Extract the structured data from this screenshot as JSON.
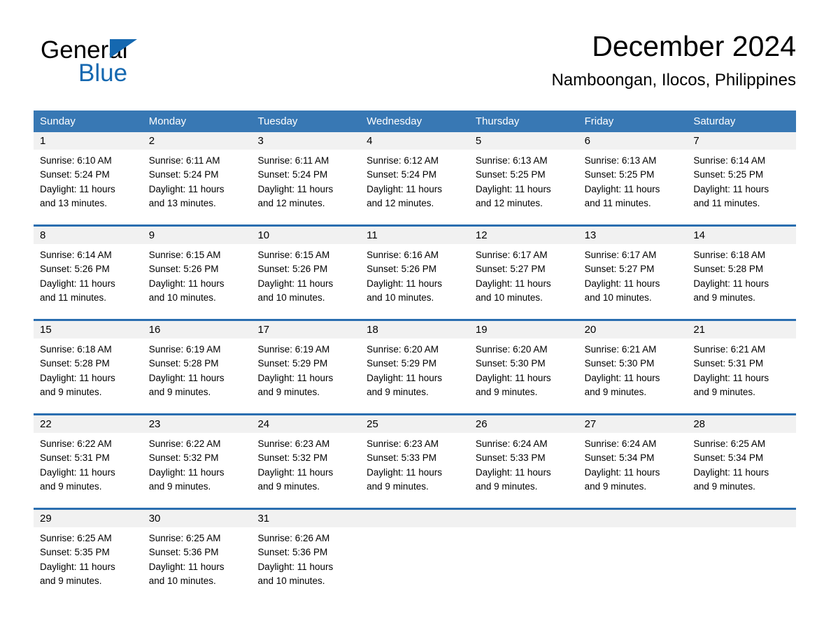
{
  "brand": {
    "name_part1": "General",
    "name_part2": "Blue",
    "triangle_color": "#1568b0"
  },
  "header": {
    "title": "December 2024",
    "subtitle": "Namboongan, Ilocos, Philippines"
  },
  "theme": {
    "header_bg": "#3878b4",
    "week_border": "#2a6eb0",
    "day_band_bg": "#f1f1f1",
    "text": "#000000"
  },
  "weekdays": [
    "Sunday",
    "Monday",
    "Tuesday",
    "Wednesday",
    "Thursday",
    "Friday",
    "Saturday"
  ],
  "labels": {
    "sunrise_prefix": "Sunrise:",
    "sunset_prefix": "Sunset:",
    "daylight_prefix": "Daylight:"
  },
  "weeks": [
    [
      {
        "day": "1",
        "sunrise": "Sunrise: 6:10 AM",
        "sunset": "Sunset: 5:24 PM",
        "daylight_line1": "Daylight: 11 hours",
        "daylight_line2": "and 13 minutes."
      },
      {
        "day": "2",
        "sunrise": "Sunrise: 6:11 AM",
        "sunset": "Sunset: 5:24 PM",
        "daylight_line1": "Daylight: 11 hours",
        "daylight_line2": "and 13 minutes."
      },
      {
        "day": "3",
        "sunrise": "Sunrise: 6:11 AM",
        "sunset": "Sunset: 5:24 PM",
        "daylight_line1": "Daylight: 11 hours",
        "daylight_line2": "and 12 minutes."
      },
      {
        "day": "4",
        "sunrise": "Sunrise: 6:12 AM",
        "sunset": "Sunset: 5:24 PM",
        "daylight_line1": "Daylight: 11 hours",
        "daylight_line2": "and 12 minutes."
      },
      {
        "day": "5",
        "sunrise": "Sunrise: 6:13 AM",
        "sunset": "Sunset: 5:25 PM",
        "daylight_line1": "Daylight: 11 hours",
        "daylight_line2": "and 12 minutes."
      },
      {
        "day": "6",
        "sunrise": "Sunrise: 6:13 AM",
        "sunset": "Sunset: 5:25 PM",
        "daylight_line1": "Daylight: 11 hours",
        "daylight_line2": "and 11 minutes."
      },
      {
        "day": "7",
        "sunrise": "Sunrise: 6:14 AM",
        "sunset": "Sunset: 5:25 PM",
        "daylight_line1": "Daylight: 11 hours",
        "daylight_line2": "and 11 minutes."
      }
    ],
    [
      {
        "day": "8",
        "sunrise": "Sunrise: 6:14 AM",
        "sunset": "Sunset: 5:26 PM",
        "daylight_line1": "Daylight: 11 hours",
        "daylight_line2": "and 11 minutes."
      },
      {
        "day": "9",
        "sunrise": "Sunrise: 6:15 AM",
        "sunset": "Sunset: 5:26 PM",
        "daylight_line1": "Daylight: 11 hours",
        "daylight_line2": "and 10 minutes."
      },
      {
        "day": "10",
        "sunrise": "Sunrise: 6:15 AM",
        "sunset": "Sunset: 5:26 PM",
        "daylight_line1": "Daylight: 11 hours",
        "daylight_line2": "and 10 minutes."
      },
      {
        "day": "11",
        "sunrise": "Sunrise: 6:16 AM",
        "sunset": "Sunset: 5:26 PM",
        "daylight_line1": "Daylight: 11 hours",
        "daylight_line2": "and 10 minutes."
      },
      {
        "day": "12",
        "sunrise": "Sunrise: 6:17 AM",
        "sunset": "Sunset: 5:27 PM",
        "daylight_line1": "Daylight: 11 hours",
        "daylight_line2": "and 10 minutes."
      },
      {
        "day": "13",
        "sunrise": "Sunrise: 6:17 AM",
        "sunset": "Sunset: 5:27 PM",
        "daylight_line1": "Daylight: 11 hours",
        "daylight_line2": "and 10 minutes."
      },
      {
        "day": "14",
        "sunrise": "Sunrise: 6:18 AM",
        "sunset": "Sunset: 5:28 PM",
        "daylight_line1": "Daylight: 11 hours",
        "daylight_line2": "and 9 minutes."
      }
    ],
    [
      {
        "day": "15",
        "sunrise": "Sunrise: 6:18 AM",
        "sunset": "Sunset: 5:28 PM",
        "daylight_line1": "Daylight: 11 hours",
        "daylight_line2": "and 9 minutes."
      },
      {
        "day": "16",
        "sunrise": "Sunrise: 6:19 AM",
        "sunset": "Sunset: 5:28 PM",
        "daylight_line1": "Daylight: 11 hours",
        "daylight_line2": "and 9 minutes."
      },
      {
        "day": "17",
        "sunrise": "Sunrise: 6:19 AM",
        "sunset": "Sunset: 5:29 PM",
        "daylight_line1": "Daylight: 11 hours",
        "daylight_line2": "and 9 minutes."
      },
      {
        "day": "18",
        "sunrise": "Sunrise: 6:20 AM",
        "sunset": "Sunset: 5:29 PM",
        "daylight_line1": "Daylight: 11 hours",
        "daylight_line2": "and 9 minutes."
      },
      {
        "day": "19",
        "sunrise": "Sunrise: 6:20 AM",
        "sunset": "Sunset: 5:30 PM",
        "daylight_line1": "Daylight: 11 hours",
        "daylight_line2": "and 9 minutes."
      },
      {
        "day": "20",
        "sunrise": "Sunrise: 6:21 AM",
        "sunset": "Sunset: 5:30 PM",
        "daylight_line1": "Daylight: 11 hours",
        "daylight_line2": "and 9 minutes."
      },
      {
        "day": "21",
        "sunrise": "Sunrise: 6:21 AM",
        "sunset": "Sunset: 5:31 PM",
        "daylight_line1": "Daylight: 11 hours",
        "daylight_line2": "and 9 minutes."
      }
    ],
    [
      {
        "day": "22",
        "sunrise": "Sunrise: 6:22 AM",
        "sunset": "Sunset: 5:31 PM",
        "daylight_line1": "Daylight: 11 hours",
        "daylight_line2": "and 9 minutes."
      },
      {
        "day": "23",
        "sunrise": "Sunrise: 6:22 AM",
        "sunset": "Sunset: 5:32 PM",
        "daylight_line1": "Daylight: 11 hours",
        "daylight_line2": "and 9 minutes."
      },
      {
        "day": "24",
        "sunrise": "Sunrise: 6:23 AM",
        "sunset": "Sunset: 5:32 PM",
        "daylight_line1": "Daylight: 11 hours",
        "daylight_line2": "and 9 minutes."
      },
      {
        "day": "25",
        "sunrise": "Sunrise: 6:23 AM",
        "sunset": "Sunset: 5:33 PM",
        "daylight_line1": "Daylight: 11 hours",
        "daylight_line2": "and 9 minutes."
      },
      {
        "day": "26",
        "sunrise": "Sunrise: 6:24 AM",
        "sunset": "Sunset: 5:33 PM",
        "daylight_line1": "Daylight: 11 hours",
        "daylight_line2": "and 9 minutes."
      },
      {
        "day": "27",
        "sunrise": "Sunrise: 6:24 AM",
        "sunset": "Sunset: 5:34 PM",
        "daylight_line1": "Daylight: 11 hours",
        "daylight_line2": "and 9 minutes."
      },
      {
        "day": "28",
        "sunrise": "Sunrise: 6:25 AM",
        "sunset": "Sunset: 5:34 PM",
        "daylight_line1": "Daylight: 11 hours",
        "daylight_line2": "and 9 minutes."
      }
    ],
    [
      {
        "day": "29",
        "sunrise": "Sunrise: 6:25 AM",
        "sunset": "Sunset: 5:35 PM",
        "daylight_line1": "Daylight: 11 hours",
        "daylight_line2": "and 9 minutes."
      },
      {
        "day": "30",
        "sunrise": "Sunrise: 6:25 AM",
        "sunset": "Sunset: 5:36 PM",
        "daylight_line1": "Daylight: 11 hours",
        "daylight_line2": "and 10 minutes."
      },
      {
        "day": "31",
        "sunrise": "Sunrise: 6:26 AM",
        "sunset": "Sunset: 5:36 PM",
        "daylight_line1": "Daylight: 11 hours",
        "daylight_line2": "and 10 minutes."
      },
      {
        "day": "",
        "sunrise": "",
        "sunset": "",
        "daylight_line1": "",
        "daylight_line2": ""
      },
      {
        "day": "",
        "sunrise": "",
        "sunset": "",
        "daylight_line1": "",
        "daylight_line2": ""
      },
      {
        "day": "",
        "sunrise": "",
        "sunset": "",
        "daylight_line1": "",
        "daylight_line2": ""
      },
      {
        "day": "",
        "sunrise": "",
        "sunset": "",
        "daylight_line1": "",
        "daylight_line2": ""
      }
    ]
  ]
}
